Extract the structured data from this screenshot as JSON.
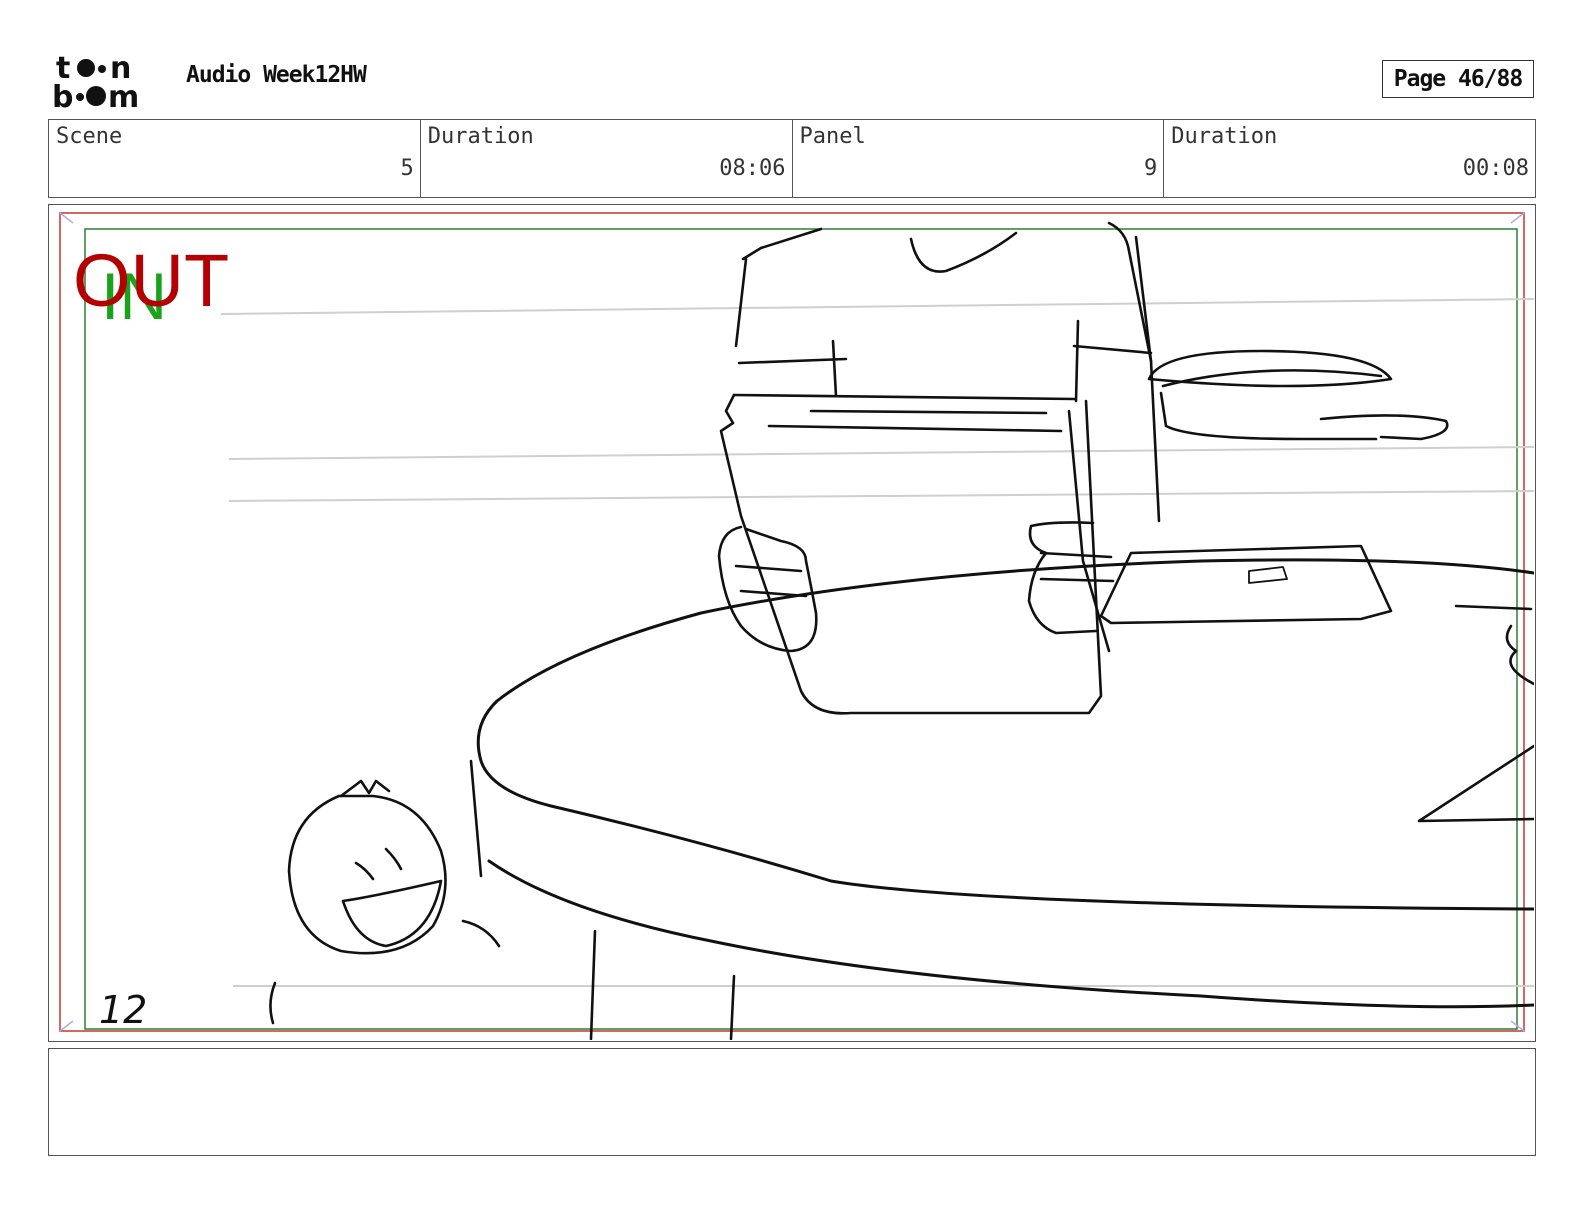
{
  "header": {
    "logo_text": "toon boom",
    "project_title": "Audio Week12HW",
    "page_label": "Page 46/88"
  },
  "info": {
    "scene_label": "Scene",
    "scene_value": "5",
    "scene_duration_label": "Duration",
    "scene_duration_value": "08:06",
    "panel_label": "Panel",
    "panel_value": "9",
    "panel_duration_label": "Duration",
    "panel_duration_value": "00:08"
  },
  "panel": {
    "out_marker": "OUT",
    "in_marker": "IN",
    "handwritten_number": "12",
    "colors": {
      "out": "#b40000",
      "in": "#1aa31a",
      "safe_frame": "#2e7d32",
      "outer_frame": "#c0392b"
    }
  },
  "caption": {
    "text": ""
  }
}
